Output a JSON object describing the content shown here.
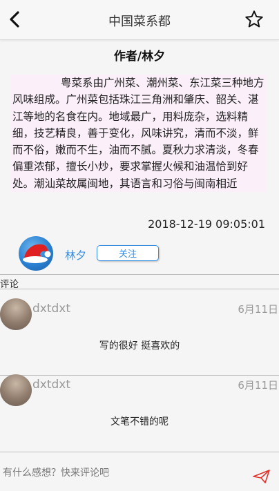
{
  "header": {
    "title": "中国菜系都",
    "back_icon": "chevron-left-icon",
    "favorite_icon": "star-outline-icon"
  },
  "article": {
    "author_line": "作者/林夕",
    "body": "粤菜系由广州菜、潮州菜、东江菜三种地方风味组成。广州菜包括珠江三角洲和肇庆、韶关、湛江等地的名食在内。地域最广，用料庞杂，选料精细，技艺精良，善于变化，风味讲究，清而不淡，鲜而不俗，嫩而不生，油而不腻。夏秋力求清淡，冬春偏重浓郁，擅长小炒，要求掌握火候和油温恰到好处。潮汕菜故属闽地，其语言和习俗与闽南相近",
    "timestamp": "2018-12-19 09:05:01"
  },
  "author": {
    "name": "林夕",
    "follow_label": "关注"
  },
  "comments": {
    "section_label": "评论",
    "items": [
      {
        "user": "dxtdxt",
        "date": "6月11日",
        "text": "写的很好 挺喜欢的"
      },
      {
        "user": "dxtdxt",
        "date": "6月11日",
        "text": "文笔不错的呢"
      }
    ]
  },
  "input": {
    "placeholder": "有什么感想？快来评论吧",
    "value": ""
  },
  "colors": {
    "accent": "#3a8fe0",
    "article_bg": "#fbeffa",
    "send_icon": "#e0342b"
  }
}
